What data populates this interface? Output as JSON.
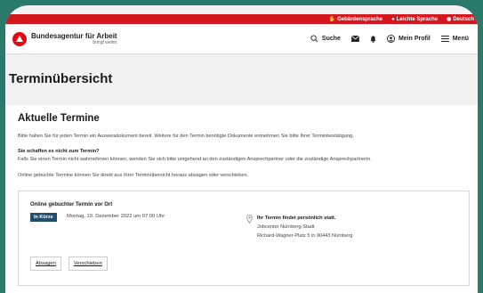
{
  "accessibility": {
    "sign_language": "Gebärdensprache",
    "easy_language": "Leichte Sprache",
    "language": "Deutsch"
  },
  "header": {
    "org_name": "Bundesagentur für Arbeit",
    "claim": "bringt weiter",
    "search": "Suche",
    "profile": "Mein Profil",
    "menu": "Menü"
  },
  "page": {
    "title": "Terminübersicht",
    "section_title": "Aktuelle Termine",
    "info_text": "Bitte halten Sie für jeden Termin ein Ausweisdokument bereit. Weitere für den Termin benötigte Dokumente entnehmen Sie bitte Ihrer Terminbestätigung.",
    "missed_heading": "Sie schaffen es nicht zum Termin?",
    "missed_text": "Falls Sie einen Termin nicht wahrnehmen können, wenden Sie sich bitte umgehend an den zuständigen Ansprechpartner oder die zuständige Ansprechpartnerin.",
    "online_text": "Online gebuchte Termine können Sie direkt aus Ihrer Terminübersicht heraus absagen oder verschieben."
  },
  "appointment": {
    "title": "Online gebuchter Termin vor Ort",
    "badge": "In Kürze",
    "date": "Montag, 19. Dezember 2022 um 07:00 Uhr",
    "location_heading": "Ihr Termin findet persönlich statt.",
    "office": "Jobcenter Nürnberg-Stadt",
    "address": "Richard-Wagner-Platz 5 in 90443 Nürnberg",
    "cancel": "Absagen",
    "reschedule": "Verschieben"
  },
  "colors": {
    "brand_red": "#d4171f",
    "badge_blue": "#1f4f70"
  }
}
